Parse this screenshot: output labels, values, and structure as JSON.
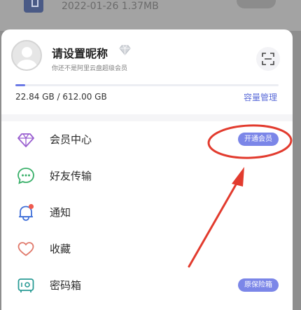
{
  "background_item": {
    "meta": "2022-01-26 1.37MB"
  },
  "profile": {
    "nickname": "请设置昵称",
    "vip_note": "你还不是阿里云盘超级会员"
  },
  "storage": {
    "used_total": "22.84 GB / 612.00 GB",
    "manage_label": "容量管理",
    "fill_fraction": 0.037
  },
  "menu": [
    {
      "label": "会员中心",
      "icon": "diamond-icon",
      "badge": "开通会员"
    },
    {
      "label": "好友传输",
      "icon": "chat-icon",
      "badge": ""
    },
    {
      "label": "通知",
      "icon": "bell-icon",
      "badge": ""
    },
    {
      "label": "收藏",
      "icon": "heart-icon",
      "badge": ""
    },
    {
      "label": "密码箱",
      "icon": "safe-icon",
      "badge": "原保险箱"
    }
  ],
  "colors": {
    "accent": "#7b86e8",
    "annotation_red": "#e23b2e"
  }
}
